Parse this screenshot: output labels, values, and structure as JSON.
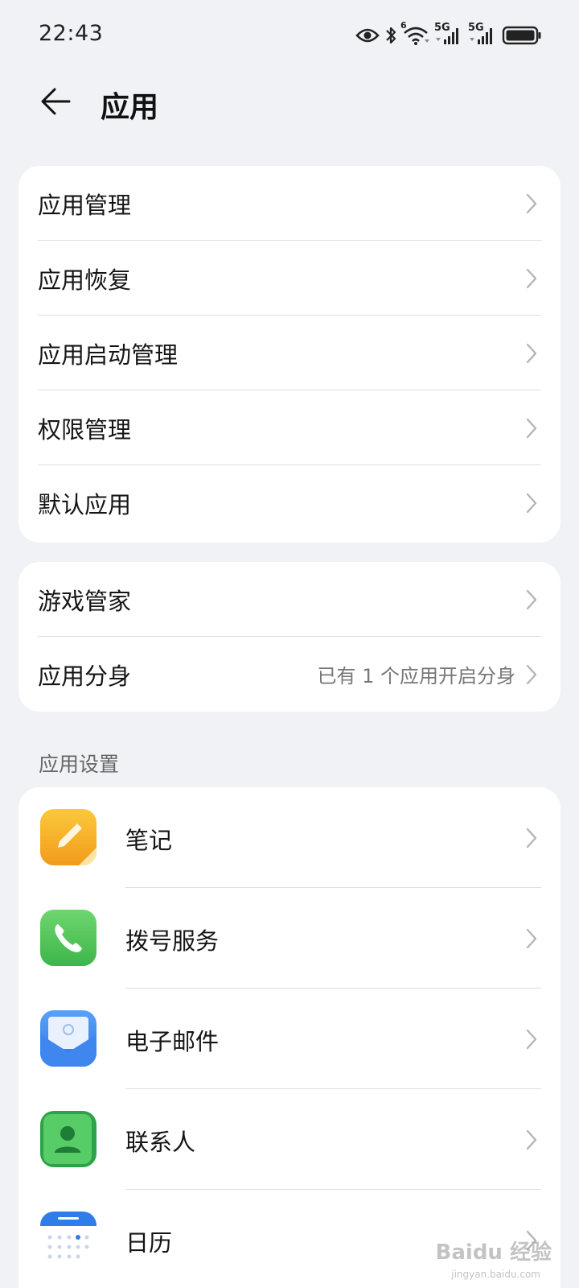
{
  "status_bar": {
    "time": "22:43",
    "icons": [
      "eye-icon",
      "bluetooth-icon",
      "wifi-icon",
      "signal-5g-icon",
      "signal-5g-icon",
      "battery-icon"
    ],
    "wifi_badge": "6",
    "network_label_1": "5G",
    "network_label_2": "5G"
  },
  "header": {
    "title": "应用",
    "back_icon": "arrow-left-icon"
  },
  "group1": {
    "items": [
      {
        "label": "应用管理"
      },
      {
        "label": "应用恢复"
      },
      {
        "label": "应用启动管理"
      },
      {
        "label": "权限管理"
      },
      {
        "label": "默认应用"
      }
    ]
  },
  "group2": {
    "items": [
      {
        "label": "游戏管家",
        "value": ""
      },
      {
        "label": "应用分身",
        "value": "已有 1 个应用开启分身"
      }
    ]
  },
  "app_settings": {
    "header": "应用设置",
    "items": [
      {
        "label": "笔记",
        "icon": "notes-icon",
        "color": "#f5b324"
      },
      {
        "label": "拨号服务",
        "icon": "phone-icon",
        "color": "#52c55a"
      },
      {
        "label": "电子邮件",
        "icon": "mail-icon",
        "color": "#3b82f0"
      },
      {
        "label": "联系人",
        "icon": "contacts-icon",
        "color": "#3dbb58"
      },
      {
        "label": "日历",
        "icon": "calendar-icon",
        "color": "#2f7de8"
      }
    ]
  },
  "watermark": {
    "text": "Baidu 经验",
    "sub": "jingyan.baidu.com"
  },
  "colors": {
    "background": "#f1f2f6",
    "card": "#ffffff",
    "divider": "#dedede",
    "secondary_text": "#777777"
  }
}
